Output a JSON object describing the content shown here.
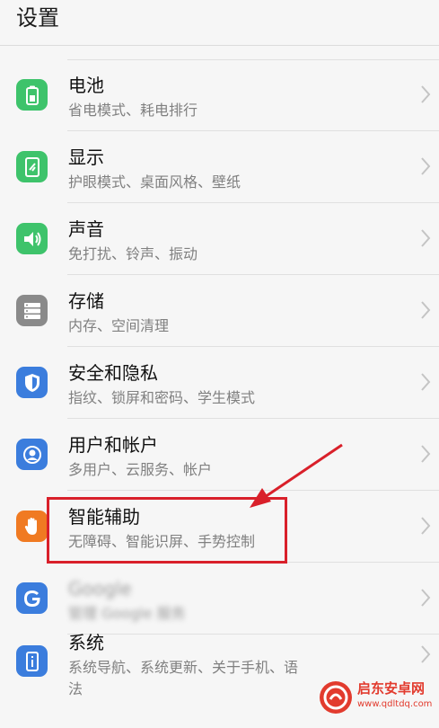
{
  "header": {
    "title": "设置"
  },
  "items": [
    {
      "title": "电池",
      "subtitle": "省电模式、耗电排行",
      "icon": "battery-icon",
      "color": "#3ec36b"
    },
    {
      "title": "显示",
      "subtitle": "护眼模式、桌面风格、壁纸",
      "icon": "display-icon",
      "color": "#3ec36b"
    },
    {
      "title": "声音",
      "subtitle": "免打扰、铃声、振动",
      "icon": "speaker-icon",
      "color": "#3ec36b"
    },
    {
      "title": "存储",
      "subtitle": "内存、空间清理",
      "icon": "storage-icon",
      "color": "#8a8a8a"
    },
    {
      "title": "安全和隐私",
      "subtitle": "指纹、锁屏和密码、学生模式",
      "icon": "shield-icon",
      "color": "#3b7ddd"
    },
    {
      "title": "用户和帐户",
      "subtitle": "多用户、云服务、帐户",
      "icon": "user-icon",
      "color": "#3b7ddd"
    },
    {
      "title": "智能辅助",
      "subtitle": "无障碍、智能识屏、手势控制",
      "icon": "hand-icon",
      "color": "#f07a22"
    },
    {
      "title": "Google",
      "subtitle": "管理 Google 服务",
      "icon": "google-icon",
      "color": "#3b7ddd"
    },
    {
      "title": "系统",
      "subtitle": "系统导航、系统更新、关于手机、语",
      "subtitle2": "法",
      "icon": "system-icon",
      "color": "#3b7ddd"
    }
  ],
  "watermark": {
    "name": "启东安卓网",
    "url": "www.qdltdq.com",
    "color": "#e23b2e"
  }
}
